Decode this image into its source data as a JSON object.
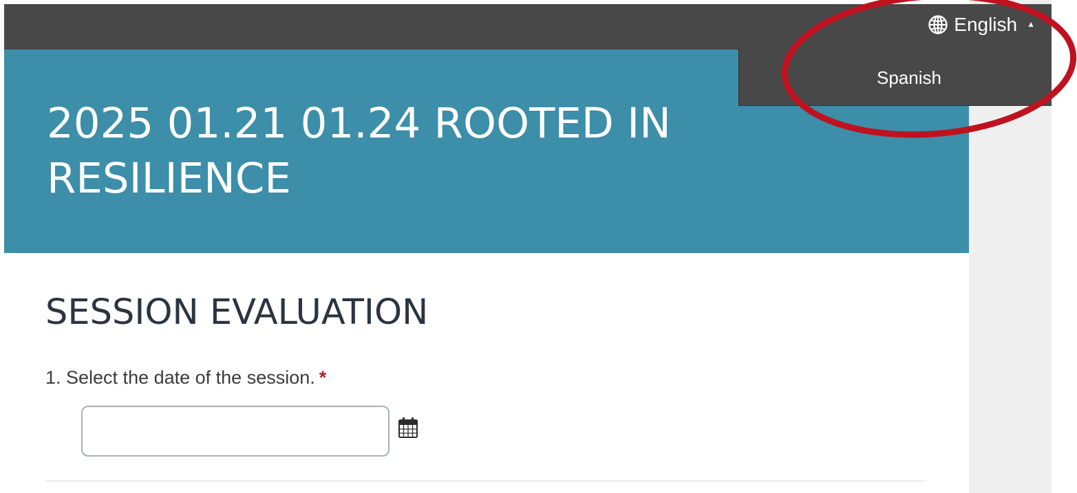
{
  "header": {
    "language_current": "English",
    "globe_icon": "globe-icon",
    "caret_icon": "caret-up-icon",
    "menu_options": [
      "Spanish"
    ]
  },
  "survey": {
    "title": "2025 01.21 01.24 ROOTED IN RESILIENCE",
    "section_title": "SESSION EVALUATION",
    "question_1": {
      "label": "1. Select the date of the session.",
      "required_marker": "*",
      "value": "",
      "picker_icon": "calendar-icon"
    }
  },
  "colors": {
    "top_bar": "#484848",
    "hero": "#3c8ea9",
    "required": "#b01e2a",
    "annotation": "#c0111f"
  }
}
